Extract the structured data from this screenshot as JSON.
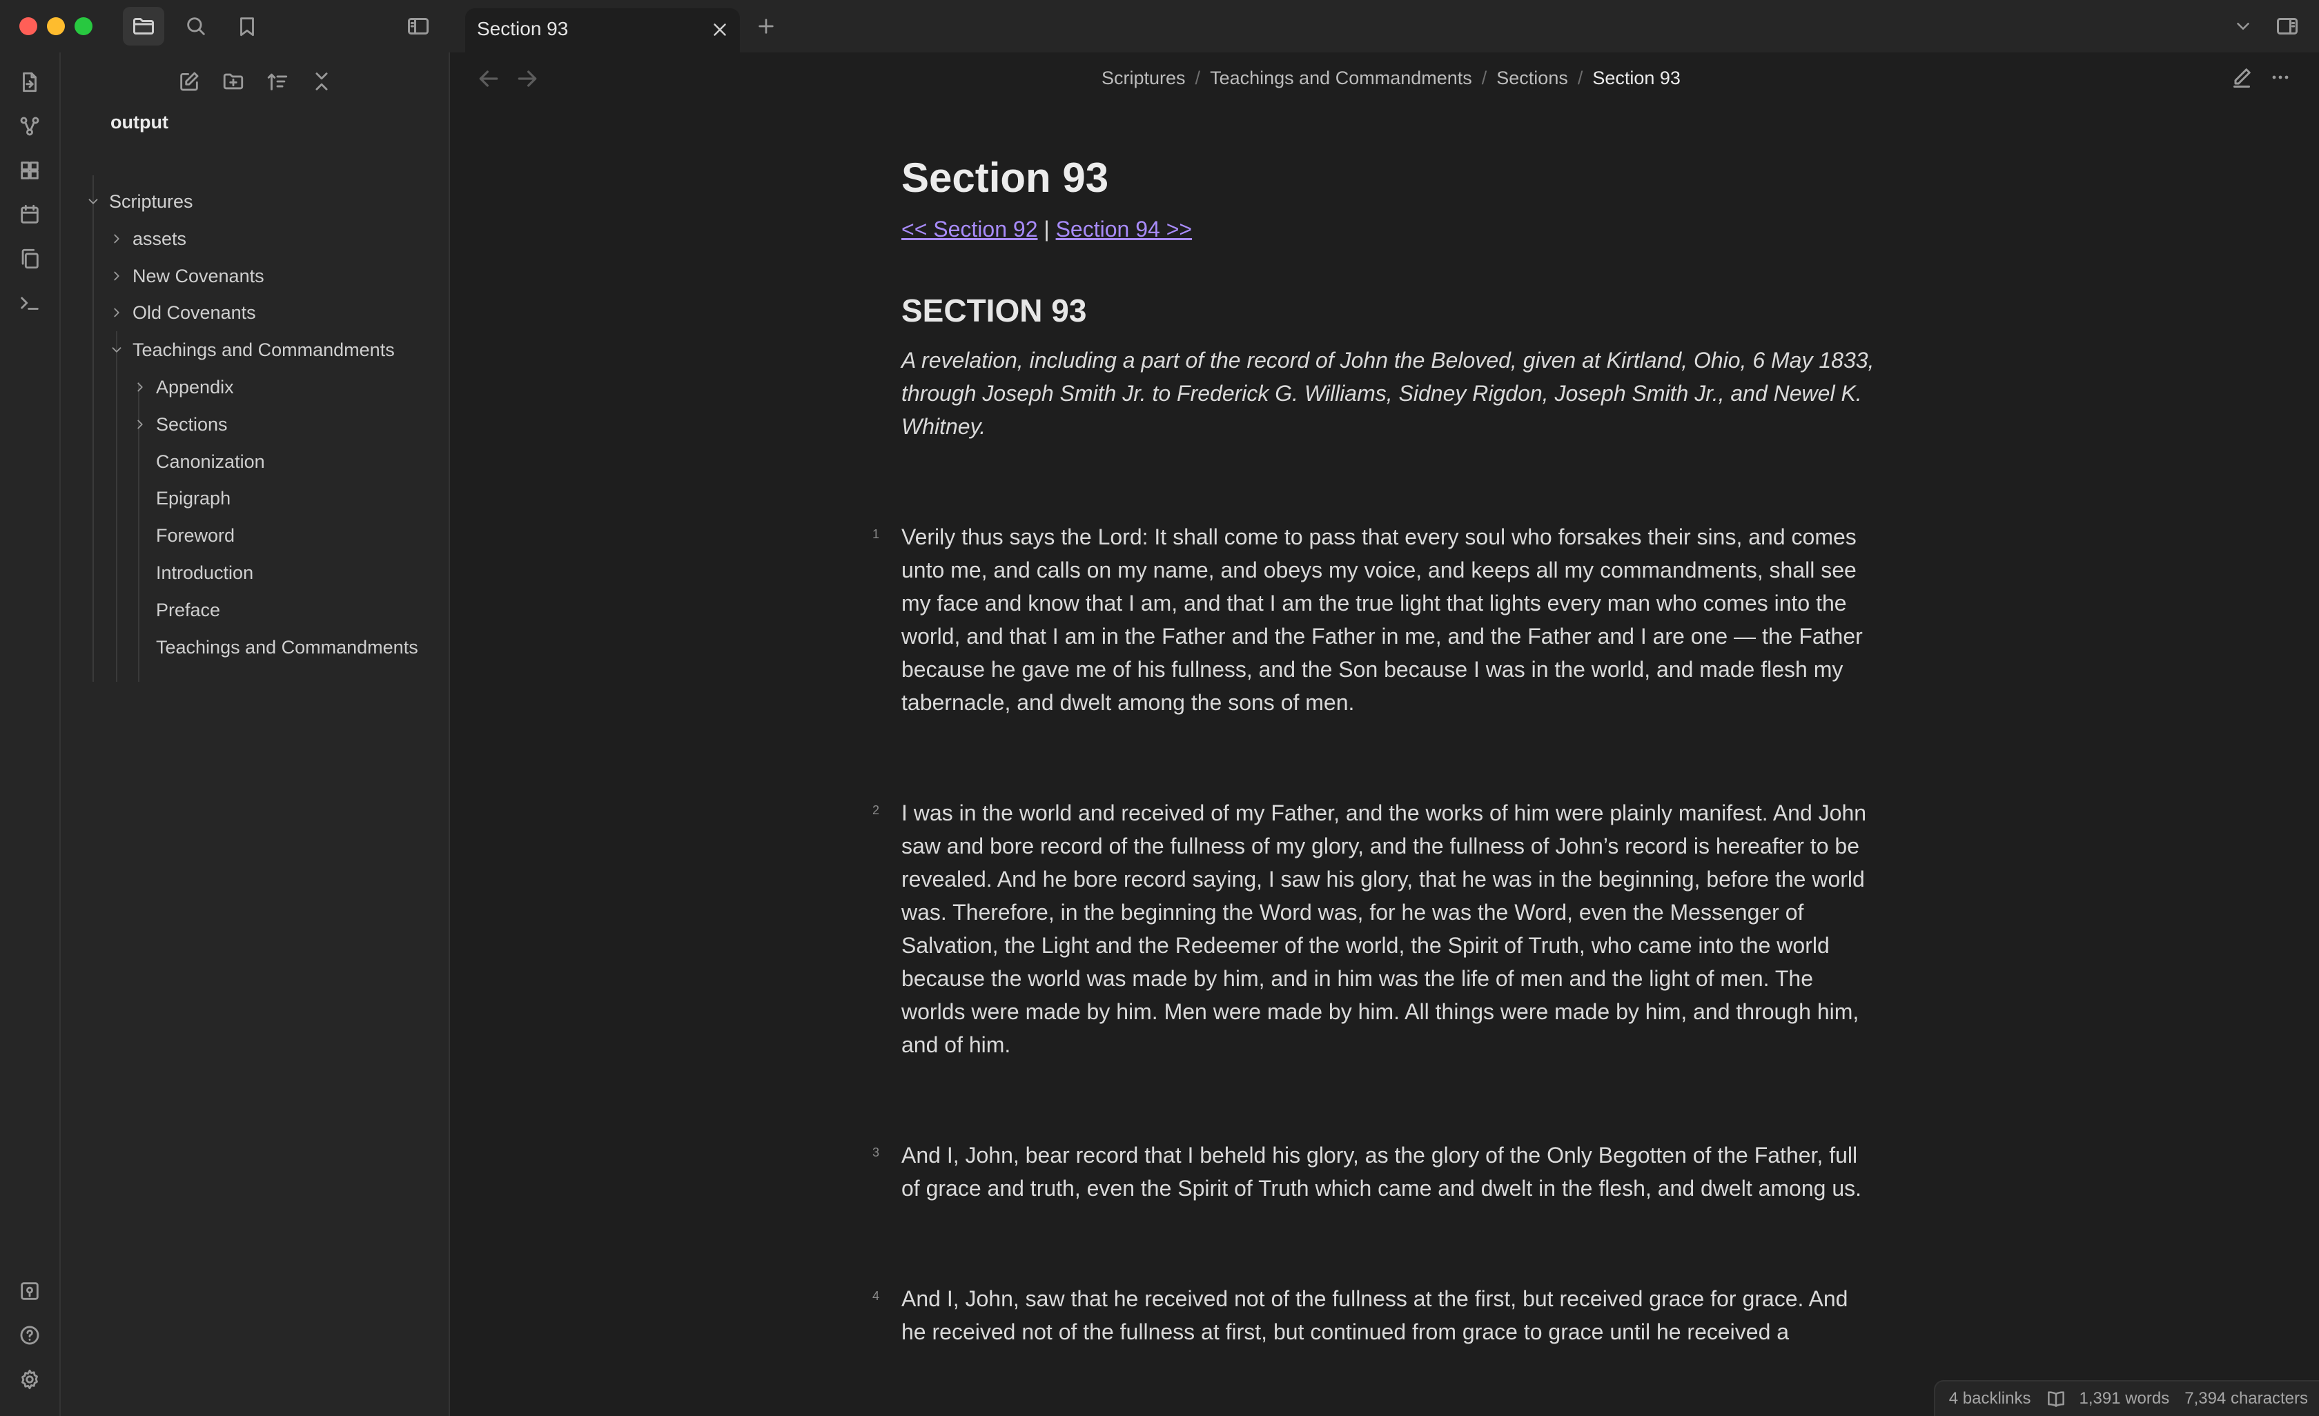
{
  "window": {
    "tab_title": "Section 93"
  },
  "sidebar": {
    "vault_name": "output",
    "tree": [
      {
        "label": "Scriptures",
        "state": "expanded"
      },
      {
        "label": "assets",
        "state": "collapsed"
      },
      {
        "label": "New Covenants",
        "state": "collapsed"
      },
      {
        "label": "Old Covenants",
        "state": "collapsed"
      },
      {
        "label": "Teachings and Commandments",
        "state": "expanded"
      },
      {
        "label": "Appendix",
        "state": "collapsed"
      },
      {
        "label": "Sections",
        "state": "collapsed"
      },
      {
        "label": "Canonization",
        "state": "file"
      },
      {
        "label": "Epigraph",
        "state": "file"
      },
      {
        "label": "Foreword",
        "state": "file"
      },
      {
        "label": "Introduction",
        "state": "file"
      },
      {
        "label": "Preface",
        "state": "file"
      },
      {
        "label": "Teachings and Commandments",
        "state": "file"
      }
    ]
  },
  "breadcrumb": [
    "Scriptures",
    "Teachings and Commandments",
    "Sections",
    "Section 93"
  ],
  "document": {
    "title": "Section 93",
    "prev_link": "<< Section 92",
    "separator": "|",
    "next_link": "Section 94 >>",
    "section_heading": "SECTION 93",
    "intro": "A revelation, including a part of the record of John the Beloved, given at Kirtland, Ohio, 6 May 1833, through Joseph Smith Jr. to Frederick G. Williams, Sidney Rigdon, Joseph Smith Jr., and Newel K. Whitney.",
    "verses": [
      {
        "num": "1",
        "text": "Verily thus says the Lord: It shall come to pass that every soul who forsakes their sins, and comes unto me, and calls on my name, and obeys my voice, and keeps all my commandments, shall see my face and know that I am, and that I am the true light that lights every man who comes into the world, and that I am in the Father and the Father in me, and the Father and I are one — the Father because he gave me of his fullness, and the Son because I was in the world, and made flesh my tabernacle, and dwelt among the sons of men."
      },
      {
        "num": "2",
        "text": "I was in the world and received of my Father, and the works of him were plainly manifest. And John saw and bore record of the fullness of my glory, and the fullness of John’s record is hereafter to be revealed. And he bore record saying, I saw his glory, that he was in the beginning, before the world was. Therefore, in the beginning the Word was, for he was the Word, even the Messenger of Salvation, the Light and the Redeemer of the world, the Spirit of Truth, who came into the world because the world was made by him, and in him was the life of men and the light of men. The worlds were made by him. Men were made by him. All things were made by him, and through him, and of him."
      },
      {
        "num": "3",
        "text": "And I, John, bear record that I beheld his glory, as the glory of the Only Begotten of the Father, full of grace and truth, even the Spirit of Truth which came and dwelt in the flesh, and dwelt among us."
      },
      {
        "num": "4",
        "text": "And I, John, saw that he received not of the fullness at the first, but received grace for grace. And he received not of the fullness at first, but continued from grace to grace until he received a"
      }
    ]
  },
  "status": {
    "backlinks": "4 backlinks",
    "words": "1,391 words",
    "characters": "7,394 characters"
  },
  "colors": {
    "link": "#a88bfa",
    "close": "#ff5f57",
    "minimize": "#febc2e",
    "zoom": "#28c840"
  }
}
